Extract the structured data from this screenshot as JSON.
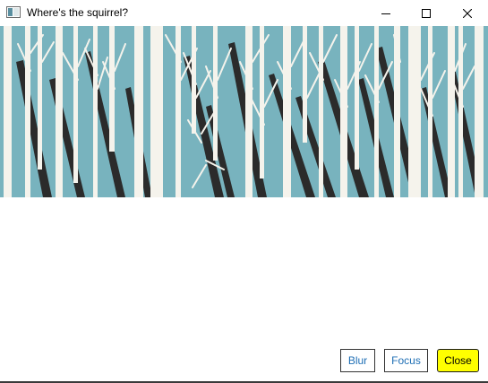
{
  "window": {
    "title": "Where's the squirrel?",
    "app_icon": "window-app-icon",
    "controls": {
      "minimize_icon": "minimize-icon",
      "maximize_icon": "maximize-icon",
      "close_icon": "close-icon"
    }
  },
  "banner": {
    "image": "birch-forest-illustration",
    "colors": {
      "sky": "#78b3be",
      "trunk": "#f5f3ec",
      "shadow": "#2b2b2b"
    }
  },
  "actions": {
    "blur_label": "Blur",
    "focus_label": "Focus",
    "close_label": "Close",
    "close_color": "#ffff00",
    "link_color": "#1f6fb5"
  }
}
